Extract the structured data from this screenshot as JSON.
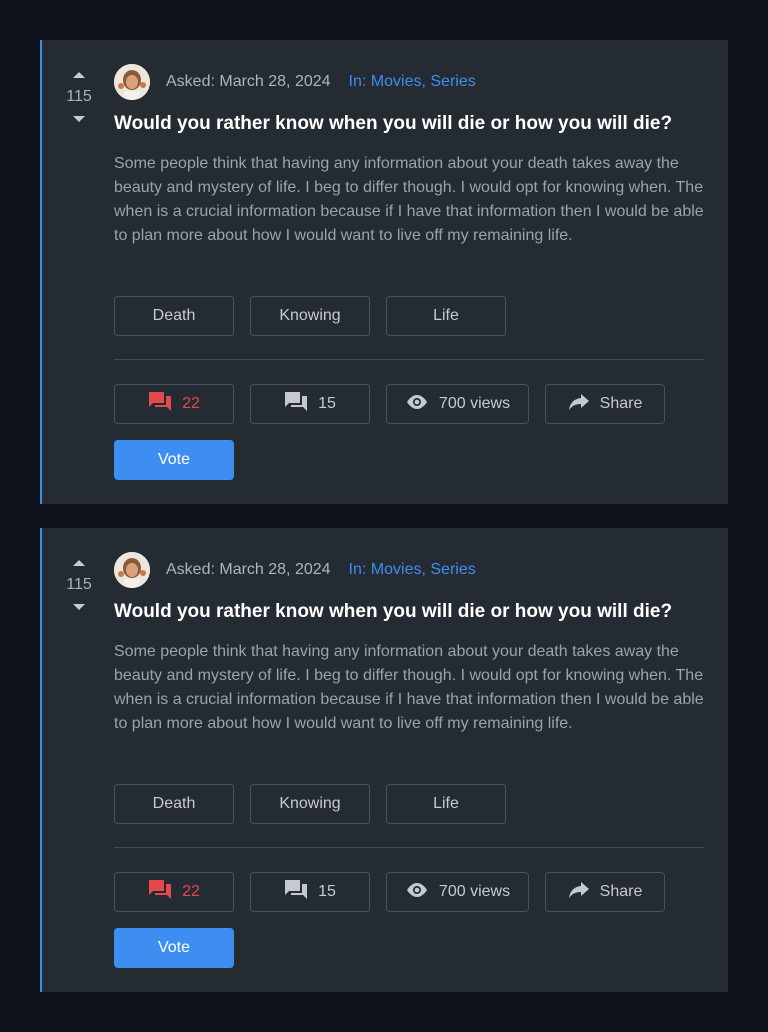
{
  "questions": [
    {
      "votes": "115",
      "asked": "Asked: March 28, 2024",
      "in_label": "In:",
      "categories": [
        "Movies",
        "Series"
      ],
      "category_sep": ", ",
      "title": "Would you rather know when you will die or how you will die?",
      "body": "Some people think that having any information about your death takes away the beauty and mystery of life. I beg to differ though. I would opt for knowing when. The when is a crucial information because if I have that information then I would be able to plan more about how I would want to live off my remaining life.",
      "tags": [
        "Death",
        "Knowing",
        "Life"
      ],
      "answers_count": "22",
      "comments_count": "15",
      "views": "700 views",
      "share_label": "Share",
      "vote_label": "Vote"
    },
    {
      "votes": "115",
      "asked": "Asked: March 28, 2024",
      "in_label": "In:",
      "categories": [
        "Movies",
        "Series"
      ],
      "category_sep": ", ",
      "title": "Would you rather know when you will die or how you will die?",
      "body": "Some people think that having any information about your death takes away the beauty and mystery of life. I beg to differ though. I would opt for knowing when. The when is a crucial information because if I have that information then I would be able to plan more about how I would want to live off my remaining life.",
      "tags": [
        "Death",
        "Knowing",
        "Life"
      ],
      "answers_count": "22",
      "comments_count": "15",
      "views": "700 views",
      "share_label": "Share",
      "vote_label": "Vote"
    }
  ],
  "colors": {
    "background": "#0d121a",
    "card": "#252b33",
    "accent": "#3d8ef0",
    "answers_red": "#e5484d"
  },
  "icons": {
    "vote_up": "caret-up-icon",
    "vote_down": "caret-down-icon",
    "answers": "forum-icon",
    "comments": "comment-icon",
    "views": "eye-icon",
    "share": "share-arrow-icon"
  }
}
